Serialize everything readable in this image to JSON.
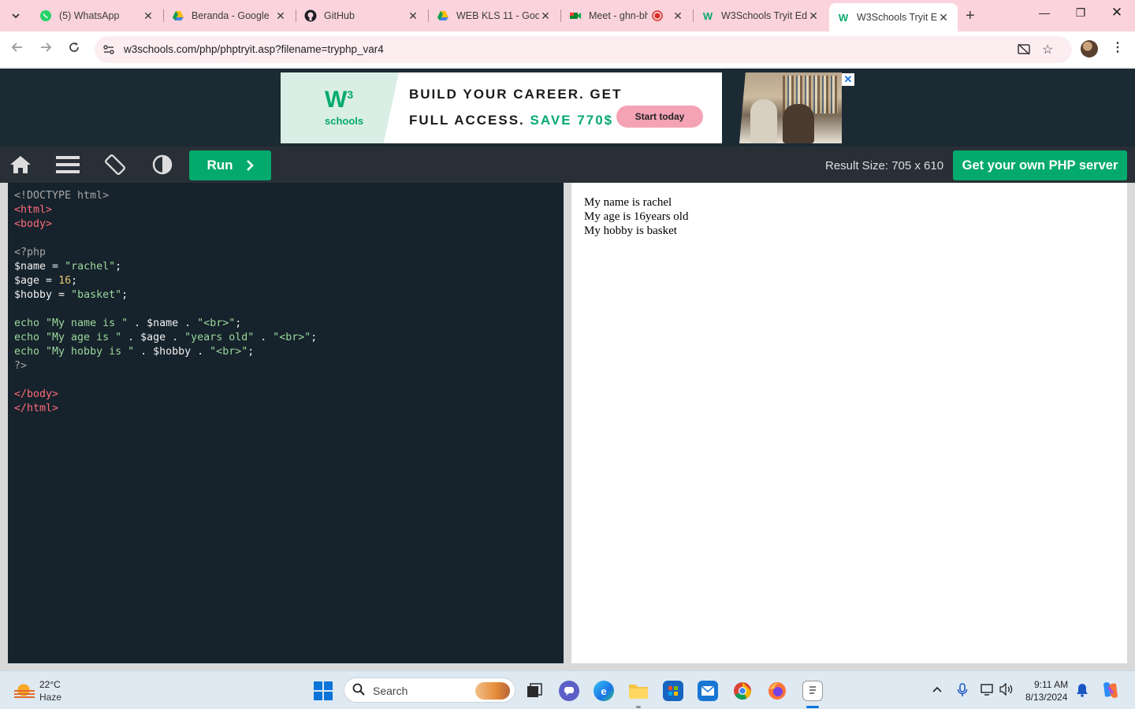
{
  "browser": {
    "tabs": [
      {
        "title": "(5) WhatsApp",
        "icon": "whatsapp-icon"
      },
      {
        "title": "Beranda - Google",
        "icon": "google-drive-icon"
      },
      {
        "title": "GitHub",
        "icon": "github-icon"
      },
      {
        "title": "WEB KLS 11 - Goo",
        "icon": "google-drive-icon"
      },
      {
        "title": "Meet - ghn-bh",
        "icon": "google-meet-icon"
      },
      {
        "title": "W3Schools Tryit Ed",
        "icon": "w3schools-icon"
      },
      {
        "title": "W3Schools Tryit Ed",
        "icon": "w3schools-icon",
        "active": true
      }
    ],
    "url": "w3schools.com/php/phptryit.asp?filename=tryphp_var4"
  },
  "ad": {
    "logo_mark": "W",
    "logo_sup": "3",
    "logo_text": "schools",
    "line1": "BUILD YOUR CAREER. GET",
    "line2_prefix": "FULL ACCESS.",
    "line2_highlight": "SAVE 770$",
    "cta": "Start today",
    "close": "✕"
  },
  "tryit": {
    "run_label": "Run",
    "result_size": "Result Size: 705 x 610",
    "server_button": "Get your own PHP server"
  },
  "code_lines": [
    "<!DOCTYPE html>",
    "<html>",
    "<body>",
    "",
    "<?php",
    "$name = \"rachel\";",
    "$age = 16;",
    "$hobby = \"basket\";",
    "",
    "echo \"My name is \" . $name . \"<br>\";",
    "echo \"My age is \" . $age . \"years old\" . \"<br>\";",
    "echo \"My hobby is \" . $hobby . \"<br>\";",
    "?>",
    "",
    "</body>",
    "</html>"
  ],
  "result_lines": [
    "My name is rachel",
    "My age is 16years old",
    "My hobby is basket"
  ],
  "taskbar": {
    "temperature": "22°C",
    "condition": "Haze",
    "search_placeholder": "Search",
    "time": "9:11 AM",
    "date": "8/13/2024"
  },
  "colors": {
    "accent_green": "#04aa6d",
    "tabstrip_pink": "#fbd3dc",
    "editor_bg": "#16222c",
    "toolbar_bg": "#282f36"
  }
}
